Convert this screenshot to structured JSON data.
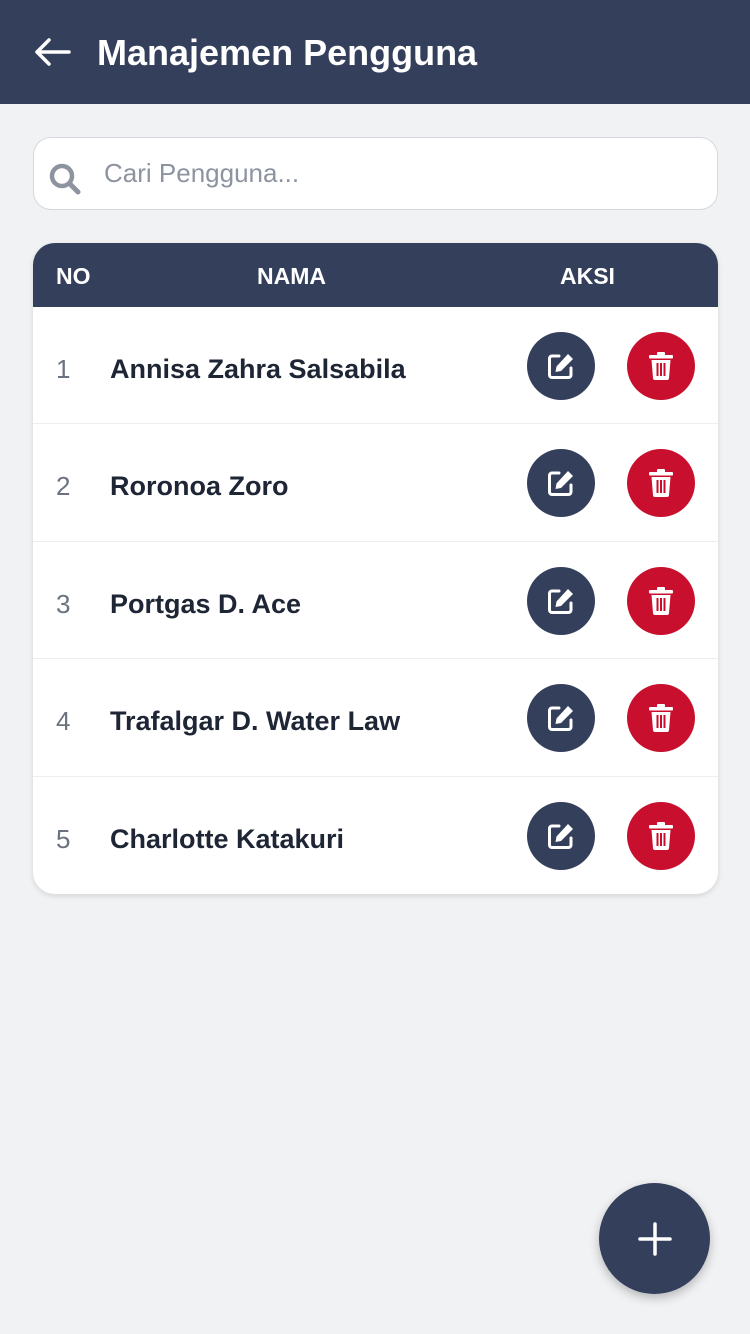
{
  "header": {
    "title": "Manajemen Pengguna",
    "back_icon": "arrow-left-icon"
  },
  "search": {
    "placeholder": "Cari Pengguna...",
    "value": "",
    "icon": "search-icon"
  },
  "table": {
    "columns": [
      "NO",
      "NAMA",
      "AKSI"
    ],
    "rows": [
      {
        "no": "1",
        "name": "Annisa Zahra Salsabila"
      },
      {
        "no": "2",
        "name": "Roronoa Zoro"
      },
      {
        "no": "3",
        "name": "Portgas D. Ace"
      },
      {
        "no": "4",
        "name": "Trafalgar D. Water Law"
      },
      {
        "no": "5",
        "name": "Charlotte Katakuri"
      }
    ],
    "row_actions": [
      "edit-icon",
      "trash-icon"
    ]
  },
  "fab": {
    "icon": "plus-icon"
  },
  "colors": {
    "primary": "#343f5b",
    "danger": "#c8102e",
    "background": "#f1f2f4"
  }
}
